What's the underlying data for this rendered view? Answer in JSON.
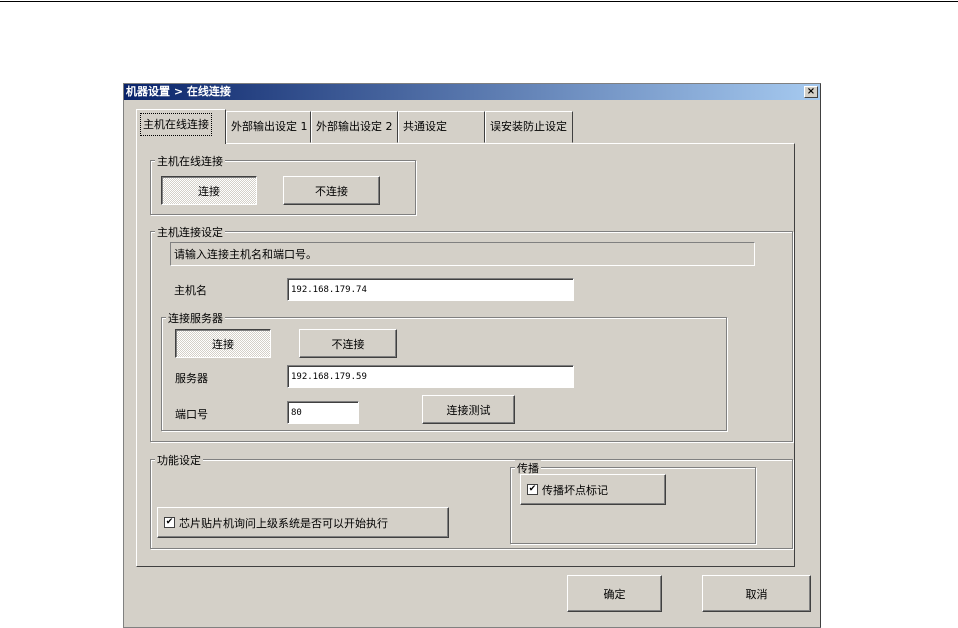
{
  "window": {
    "title": "机器设置 > 在线连接",
    "close": "×"
  },
  "tabs": [
    "主机在线连接",
    "外部输出设定 1",
    "外部输出设定 2",
    "共通设定",
    "误安装防止设定"
  ],
  "host_online": {
    "legend": "主机在线连接",
    "connect": "连接",
    "disconnect": "不连接"
  },
  "host_settings": {
    "legend": "主机连接设定",
    "info": "请输入连接主机名和端口号。",
    "host_label": "主机名",
    "host_value": "192.168.179.74",
    "server_group": {
      "legend": "连接服务器",
      "connect": "连接",
      "disconnect": "不连接",
      "server_label": "服务器",
      "server_value": "192.168.179.59",
      "port_label": "端口号",
      "port_value": "80",
      "test": "连接测试"
    }
  },
  "function": {
    "legend": "功能设定",
    "chip_check": "芯片贴片机询问上级系统是否可以开始执行",
    "chip_checked": true,
    "propagate": {
      "legend": "传播",
      "check": "传播坏点标记",
      "checked": true
    }
  },
  "footer": {
    "ok": "确定",
    "cancel": "取消"
  },
  "check_mark": "✔"
}
